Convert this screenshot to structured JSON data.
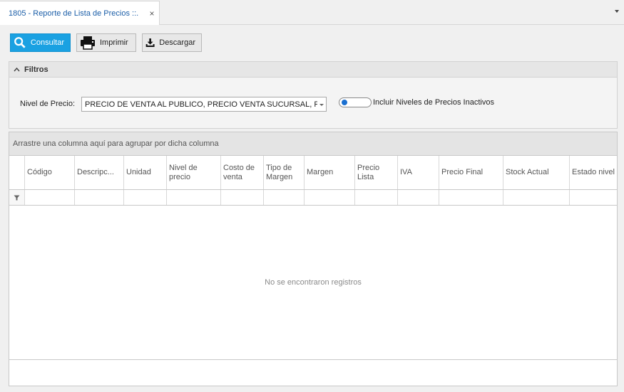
{
  "tab": {
    "title": "1805 - Reporte de Lista de Precios ::.",
    "close_glyph": "×"
  },
  "toolbar": {
    "consultar": "Consultar",
    "imprimir": "Imprimir",
    "descargar": "Descargar"
  },
  "filters": {
    "title": "Filtros",
    "nivel_label": "Nivel de Precio:",
    "nivel_value": "PRECIO DE VENTA AL PUBLICO, PRECIO VENTA SUCURSAL, PRE...",
    "toggle_label": "Incluir Niveles de Precios Inactivos"
  },
  "grid": {
    "group_hint": "Arrastre una columna aquí para agrupar por dicha columna",
    "columns": [
      "Código",
      "Descripc...",
      "Unidad",
      "Nivel de precio",
      "Costo de venta",
      "Tipo de Margen",
      "Margen",
      "Precio Lista",
      "IVA",
      "Precio Final",
      "Stock Actual",
      "Estado nivel"
    ],
    "empty_message": "No se encontraron registros"
  },
  "colors": {
    "accent": "#1aa1e2",
    "tab_text": "#1b5ea8"
  }
}
